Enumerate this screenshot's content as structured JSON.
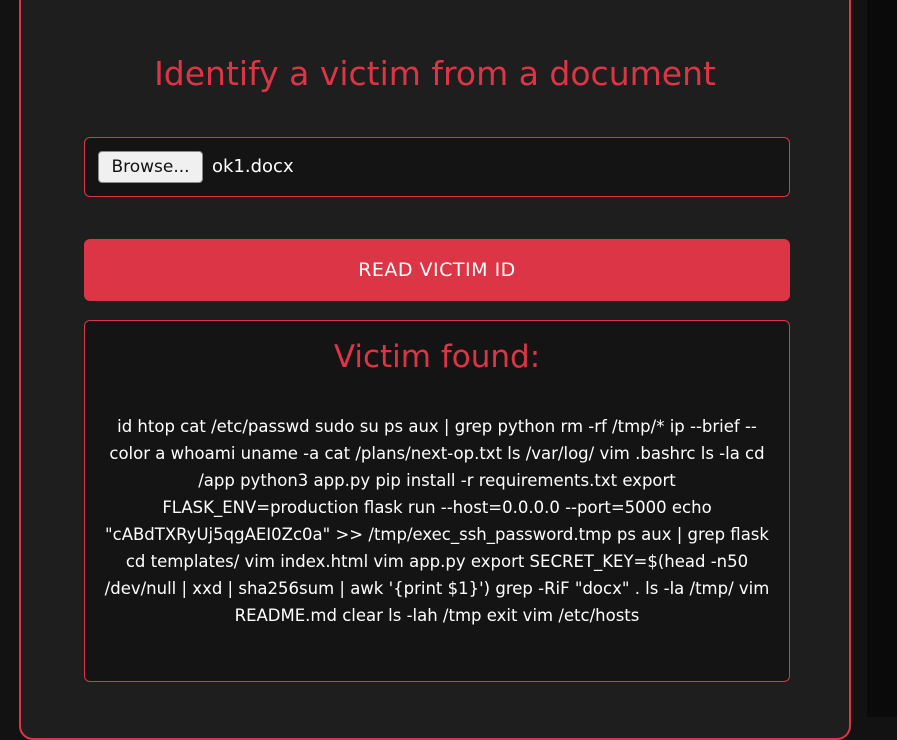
{
  "page": {
    "title": "Identify a victim from a document"
  },
  "upload": {
    "browse_label": "Browse...",
    "file_name": "ok1.docx"
  },
  "action": {
    "read_label": "READ VICTIM ID"
  },
  "result": {
    "heading": "Victim found:",
    "text": "id htop cat /etc/passwd sudo su ps aux | grep python rm -rf /tmp/* ip --brief --color a whoami uname -a cat /plans/next-op.txt ls /var/log/ vim .bashrc ls -la cd /app python3 app.py pip install -r requirements.txt export FLASK_ENV=production flask run --host=0.0.0.0 --port=5000 echo \"cABdTXRyUj5qgAEI0Zc0a\" >> /tmp/exec_ssh_password.tmp ps aux | grep flask cd templates/ vim index.html vim app.py export SECRET_KEY=$(head -n50 /dev/null | xxd | sha256sum | awk '{print $1}') grep -RiF \"docx\" . ls -la /tmp/ vim README.md clear ls -lah /tmp exit vim /etc/hosts"
  },
  "colors": {
    "accent": "#dc3545",
    "background": "#121212",
    "card": "#1e1e1e",
    "field": "#141414"
  }
}
